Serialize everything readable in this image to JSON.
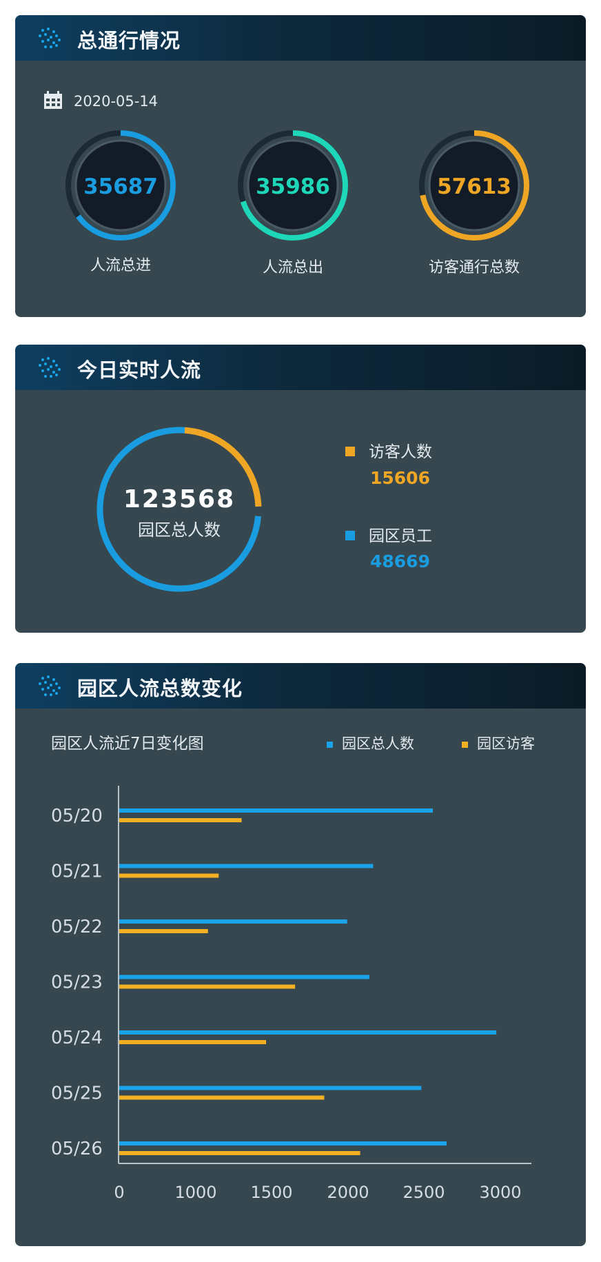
{
  "panel1": {
    "title": "总通行情况",
    "date": "2020-05-14",
    "gauges": [
      {
        "value": "35687",
        "label": "人流总进",
        "color": "#1a9de0",
        "fraction": 0.65
      },
      {
        "value": "35986",
        "label": "人流总出",
        "color": "#1ed6b8",
        "fraction": 0.7
      },
      {
        "value": "57613",
        "label": "访客通行总数",
        "color": "#efa625",
        "fraction": 0.72
      }
    ]
  },
  "panel2": {
    "title": "今日实时人流",
    "total_value": "123568",
    "total_label": "园区总人数",
    "legend": [
      {
        "name": "访客人数",
        "value": "15606",
        "color": "#efa625"
      },
      {
        "name": "园区员工",
        "value": "48669",
        "color": "#1a9de0"
      }
    ],
    "donut_fraction_visitors": 0.2428
  },
  "panel3": {
    "title": "园区人流总数变化",
    "chart_title": "园区人流近7日变化图"
  },
  "chart_data": {
    "type": "bar",
    "orientation": "horizontal",
    "title": "园区人流近7日变化图",
    "categories": [
      "05/20",
      "05/21",
      "05/22",
      "05/23",
      "05/24",
      "05/25",
      "05/26"
    ],
    "series": [
      {
        "name": "园区总人数",
        "color": "#1aa3e8",
        "values": [
          2050,
          1660,
          1490,
          1635,
          2465,
          1975,
          2140
        ]
      },
      {
        "name": "园区访客",
        "color": "#f3b023",
        "values": [
          800,
          650,
          580,
          1150,
          960,
          1340,
          1575
        ]
      }
    ],
    "xticks": [
      "0",
      "1000",
      "1500",
      "2000",
      "2500",
      "3000"
    ],
    "xlim": [
      0,
      2700
    ],
    "legend_position": "top-right",
    "grid": false
  }
}
